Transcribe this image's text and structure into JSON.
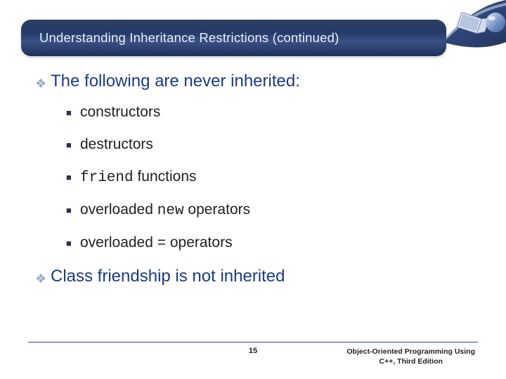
{
  "slide": {
    "title": "Understanding Inheritance Restrictions (continued)"
  },
  "body": {
    "intro": "The following are never inherited:",
    "items": {
      "a": "constructors",
      "b": "destructors",
      "c_code": "friend",
      "c_rest": " functions",
      "d_pre": "overloaded ",
      "d_code": "new",
      "d_post": " operators",
      "e": "overloaded = operators"
    },
    "closing": "Class friendship is not inherited"
  },
  "footer": {
    "page": "15",
    "book_line1": "Object-Oriented Programming Using",
    "book_line2": "C++, Third Edition"
  }
}
